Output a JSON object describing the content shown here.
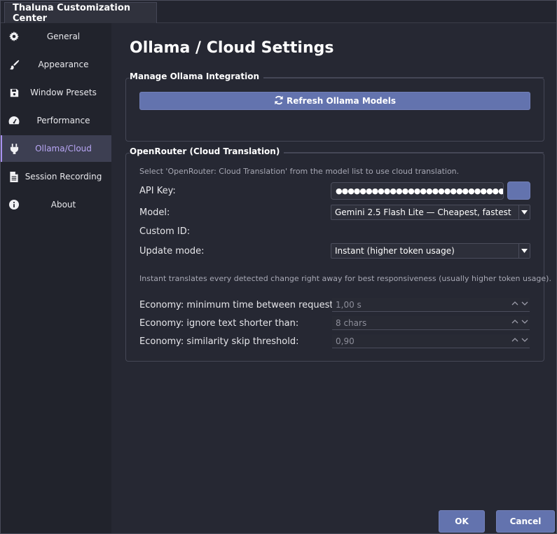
{
  "window": {
    "tab_title": "Thaluna Customization Center"
  },
  "sidebar": {
    "items": [
      {
        "label": "General",
        "icon": "gear-icon"
      },
      {
        "label": "Appearance",
        "icon": "brush-icon"
      },
      {
        "label": "Window Presets",
        "icon": "save-icon"
      },
      {
        "label": "Performance",
        "icon": "gauge-icon"
      },
      {
        "label": "Ollama/Cloud",
        "icon": "plug-icon",
        "active": true
      },
      {
        "label": "Session Recording",
        "icon": "document-icon"
      },
      {
        "label": "About",
        "icon": "info-icon"
      }
    ]
  },
  "main": {
    "title": "Ollama / Cloud Settings",
    "ollama_group": {
      "title": "Manage Ollama Integration",
      "refresh_button": "Refresh Ollama Models"
    },
    "openrouter_group": {
      "title": "OpenRouter (Cloud Translation)",
      "hint": "Select 'OpenRouter: Cloud Translation' from the model list to use cloud translation.",
      "api_key_label": "API Key:",
      "api_key_value": "●●●●●●●●●●●●●●●●●●●●●●●●●●●●●●●●",
      "model_label": "Model:",
      "model_value": "Gemini 2.5 Flash Lite — Cheapest, fastest",
      "custom_id_label": "Custom ID:",
      "update_mode_label": "Update mode:",
      "update_mode_value": "Instant (higher token usage)",
      "update_mode_hint": "Instant translates every detected change right away for best responsiveness (usually higher token usage).",
      "economy_min_time_label": "Economy: minimum time between requests:",
      "economy_min_time_value": "1,00 s",
      "economy_ignore_short_label": "Economy: ignore text shorter than:",
      "economy_ignore_short_value": "8 chars",
      "economy_similarity_label": "Economy: similarity skip threshold:",
      "economy_similarity_value": "0,90"
    }
  },
  "dialog": {
    "ok_label": "OK",
    "cancel_label": "Cancel"
  },
  "colors": {
    "accent": "#6373ae",
    "active_text": "#b8a6f5",
    "background": "#262833"
  }
}
